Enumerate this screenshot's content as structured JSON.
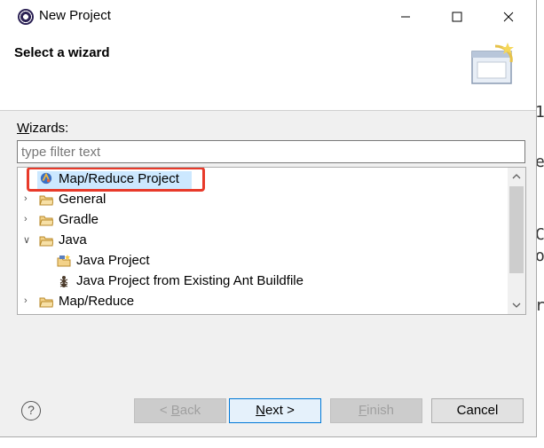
{
  "window": {
    "title": "New Project"
  },
  "header": {
    "title": "Select a wizard"
  },
  "wizards_label_prefix": "W",
  "wizards_label_rest": "izards:",
  "filter": {
    "value": "",
    "placeholder": "type filter text"
  },
  "tree": {
    "items": [
      {
        "label": "Map/Reduce Project",
        "level": 0,
        "type": "project",
        "selected": true,
        "highlighted": true
      },
      {
        "label": "General",
        "level": 0,
        "type": "folder",
        "expanded": false
      },
      {
        "label": "Gradle",
        "level": 0,
        "type": "folder",
        "expanded": false
      },
      {
        "label": "Java",
        "level": 0,
        "type": "folder",
        "expanded": true
      },
      {
        "label": "Java Project",
        "level": 1,
        "type": "java-project"
      },
      {
        "label": "Java Project from Existing Ant Buildfile",
        "level": 1,
        "type": "ant-project"
      },
      {
        "label": "Map/Reduce",
        "level": 0,
        "type": "folder",
        "expanded": false
      }
    ]
  },
  "buttons": {
    "back_prefix": "< ",
    "back_mnemonic": "B",
    "back_rest": "ack",
    "next_mnemonic": "N",
    "next_rest": "ext >",
    "finish_mnemonic": "F",
    "finish_rest": "inish",
    "cancel": "Cancel"
  },
  "background_fragments": [
    "1",
    "e",
    "C",
    "o",
    "r"
  ],
  "colors": {
    "highlight": "#cce8ff",
    "annotation_red": "#e83a2a",
    "primary_border": "#0078d7"
  }
}
